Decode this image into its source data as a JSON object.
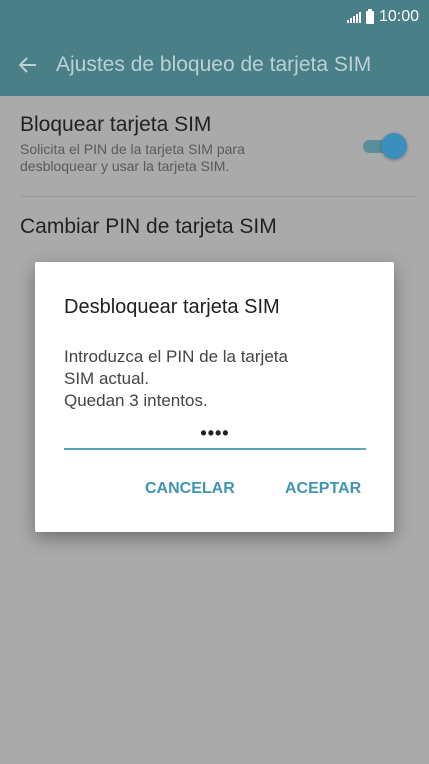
{
  "status_bar": {
    "time": "10:00"
  },
  "app_bar": {
    "title": "Ajustes de bloqueo de tarjeta SIM"
  },
  "settings": {
    "lock_sim": {
      "title": "Bloquear tarjeta SIM",
      "summary_line1": "Solicita el PIN de la tarjeta SIM para",
      "summary_line2": "desbloquear y usar la tarjeta SIM.",
      "enabled": true
    },
    "change_pin": {
      "title": "Cambiar PIN de tarjeta SIM"
    }
  },
  "dialog": {
    "title": "Desbloquear tarjeta SIM",
    "message_line1": "Introduzca el PIN de la tarjeta",
    "message_line2": "SIM actual.",
    "message_line3": "Quedan 3 intentos.",
    "pin_value": "••••",
    "cancel_label": "CANCELAR",
    "accept_label": "ACEPTAR"
  },
  "colors": {
    "accent": "#3f95b3",
    "app_bar": "#4a7f88",
    "scrim": "#aaaaaa"
  },
  "icons": {
    "back": "arrow-back-icon",
    "signal": "signal-icon",
    "battery": "battery-icon"
  }
}
